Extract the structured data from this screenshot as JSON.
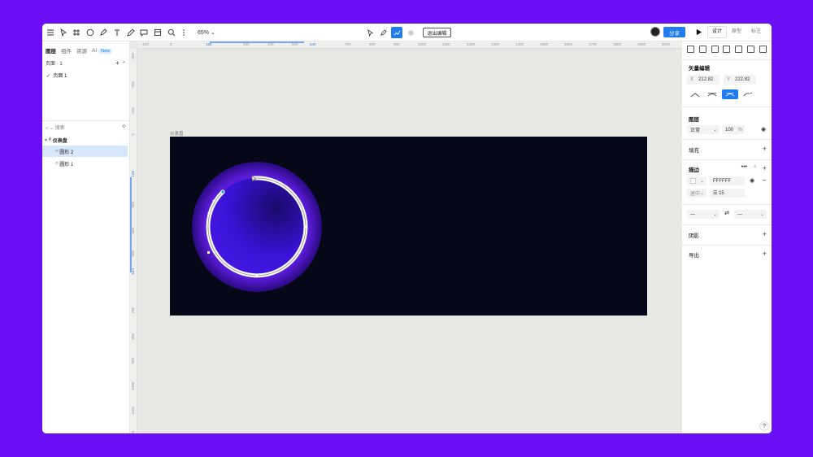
{
  "toolbar": {
    "zoom": "65%",
    "exit_edit": "退出编辑",
    "share": "分享",
    "modes": [
      "设计",
      "原型",
      "标注"
    ],
    "active_mode": "设计"
  },
  "left_panel": {
    "tabs": [
      "图层",
      "组件",
      "资源",
      "AI"
    ],
    "new_badge": "New",
    "pages_header": "页面 · 1",
    "page_item": "页面 1",
    "search_placeholder": "搜索",
    "layers": [
      {
        "label": "仪表盘",
        "type": "frame"
      },
      {
        "label": "圆形 2",
        "type": "ellipse",
        "selected": true
      },
      {
        "label": "圆形 1",
        "type": "ellipse",
        "selected": false
      }
    ]
  },
  "canvas": {
    "frame_label": "仪表盘",
    "ruler_top": [
      "-100",
      "0",
      "156",
      "300",
      "400",
      "500",
      "544",
      "700",
      "800",
      "900",
      "1000",
      "1100",
      "1200",
      "1300",
      "1400",
      "1500",
      "1600",
      "1700",
      "1800",
      "1900",
      "2000"
    ],
    "ruler_left": [
      "-300",
      "-200",
      "-100",
      "0",
      "156",
      "300",
      "400",
      "500",
      "544",
      "700",
      "800",
      "900",
      "1000",
      "1100",
      "1200"
    ],
    "colors": {
      "frame_bg": "#050816",
      "accent": "#1e7bf0",
      "circle_inner": "#3a0fd8",
      "stroke": "#ffffff"
    }
  },
  "right_panel": {
    "vector_edit_title": "矢量编辑",
    "x_label": "X",
    "x_value": "212.82",
    "y_label": "Y",
    "y_value": "222.82",
    "layer_title": "图层",
    "blend_mode": "正常",
    "opacity": "100",
    "opacity_unit": "%",
    "fill_title": "填充",
    "stroke_title": "描边",
    "stroke_color": "FFFFFF",
    "stroke_align": "居中",
    "stroke_width": "15",
    "cap_start": "—",
    "cap_end": "—",
    "shadow_title": "阴影",
    "export_title": "导出"
  },
  "help_label": "?"
}
